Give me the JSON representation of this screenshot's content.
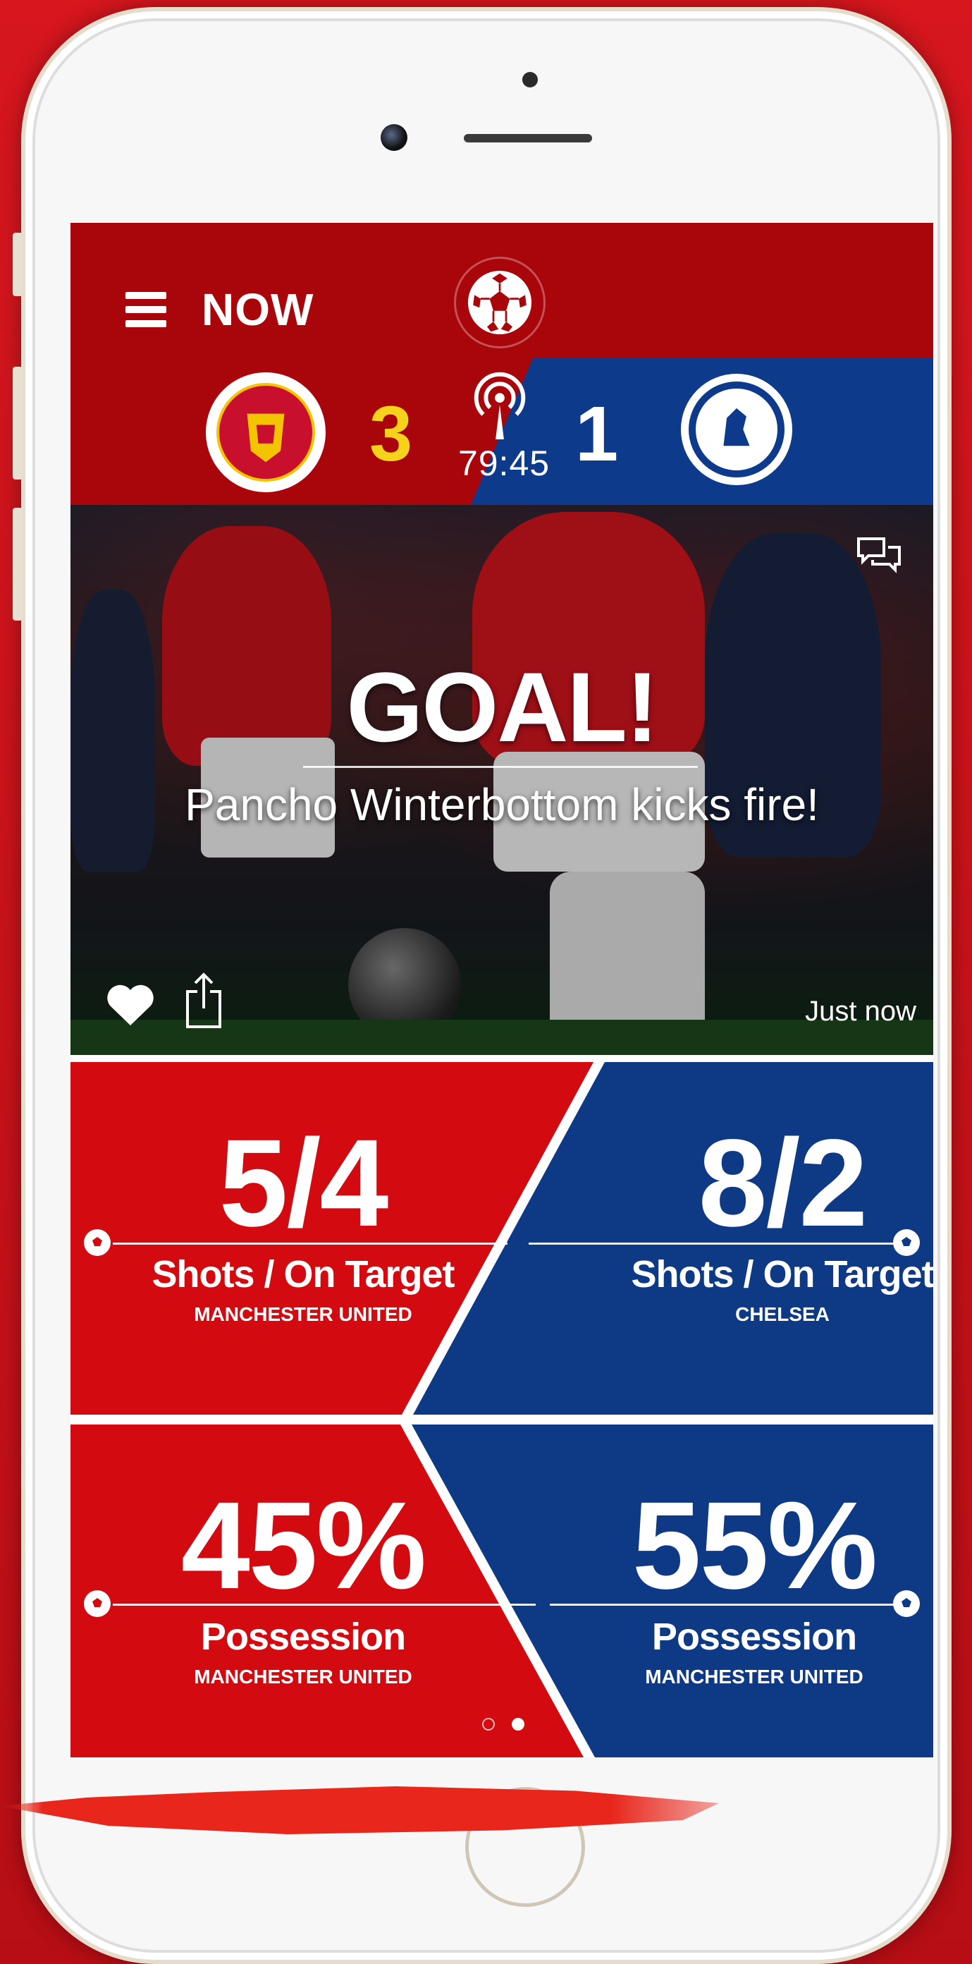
{
  "header": {
    "title": "NOW",
    "menu_icon": "hamburger-menu-icon",
    "center_icon": "soccer-ball-icon"
  },
  "match": {
    "home_team": "Manchester United",
    "away_team": "Chelsea",
    "home_score": "3",
    "away_score": "1",
    "clock": "79:45",
    "live_icon": "live-broadcast-icon",
    "colors": {
      "home": "#a9060c",
      "away": "#0d3a8a",
      "home_score": "#f6d21a"
    }
  },
  "event": {
    "title": "GOAL!",
    "subtitle": "Pancho Winterbottom kicks fire!",
    "timestamp": "Just now",
    "icons": [
      "comment-icon",
      "heart-icon",
      "share-icon"
    ]
  },
  "stats": [
    {
      "value": "5/4",
      "label": "Shots / On Target",
      "team": "MANCHESTER UNITED"
    },
    {
      "value": "8/2",
      "label": "Shots / On Target",
      "team": "CHELSEA"
    },
    {
      "value": "45%",
      "label": "Possession",
      "team": "MANCHESTER UNITED"
    },
    {
      "value": "55%",
      "label": "Possession",
      "team": "MANCHESTER UNITED"
    }
  ],
  "pager": {
    "pages": 2,
    "active": 2
  }
}
